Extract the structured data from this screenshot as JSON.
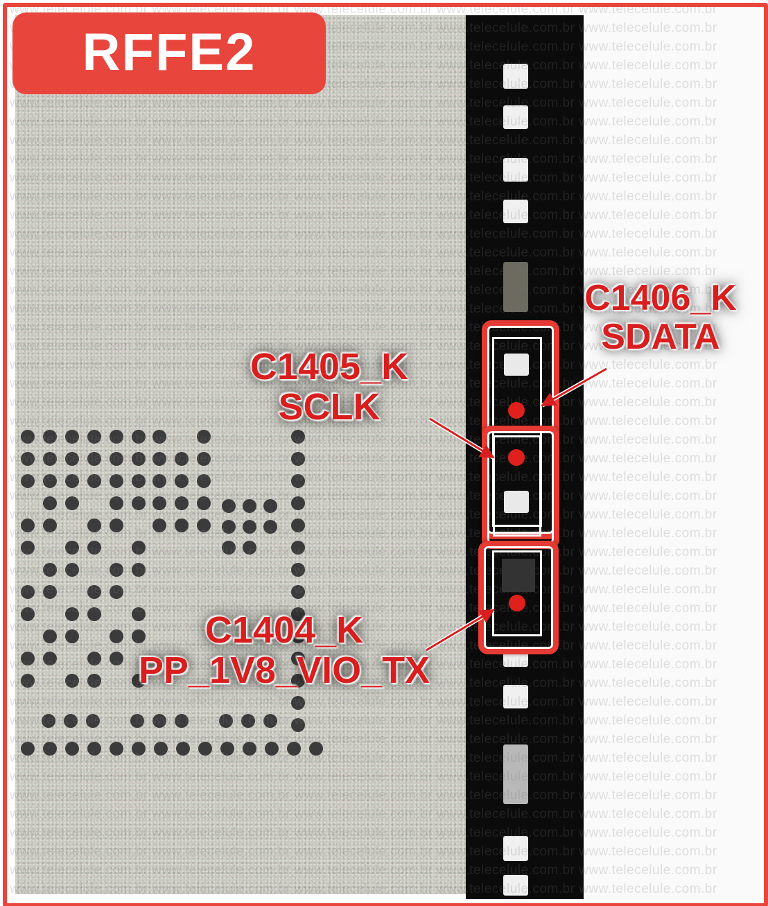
{
  "title": "RFFE2",
  "watermark": "www.telecelule.com.br",
  "colors": {
    "accent": "#e8453c",
    "label_text": "#d81e1e",
    "marker": "#e0201c"
  },
  "labels": {
    "c1406": {
      "ref": "C1406_K",
      "net": "SDATA"
    },
    "c1405": {
      "ref": "C1405_K",
      "net": "SCLK"
    },
    "c1404": {
      "ref": "C1404_K",
      "net": "PP_1V8_VIO_TX"
    }
  }
}
